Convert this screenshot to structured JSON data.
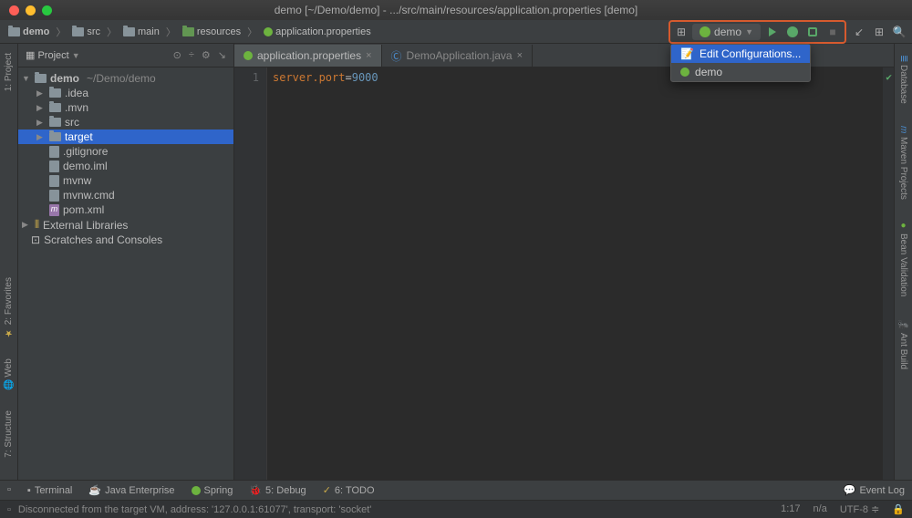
{
  "title": "demo [~/Demo/demo] - .../src/main/resources/application.properties [demo]",
  "breadcrumb": [
    "demo",
    "src",
    "main",
    "resources",
    "application.properties"
  ],
  "run_config": {
    "selected": "demo",
    "dropdown": [
      "Edit Configurations...",
      "demo"
    ]
  },
  "sidebar": {
    "header": "Project",
    "root": {
      "name": "demo",
      "path": "~/Demo/demo"
    },
    "nodes": [
      {
        "name": ".idea",
        "type": "folder",
        "depth": 1,
        "arrow": "▶"
      },
      {
        "name": ".mvn",
        "type": "folder",
        "depth": 1,
        "arrow": "▶"
      },
      {
        "name": "src",
        "type": "folder",
        "depth": 1,
        "arrow": "▶"
      },
      {
        "name": "target",
        "type": "folder-orange",
        "depth": 1,
        "arrow": "▶",
        "sel": true
      },
      {
        "name": ".gitignore",
        "type": "file",
        "depth": 1
      },
      {
        "name": "demo.iml",
        "type": "file",
        "depth": 1
      },
      {
        "name": "mvnw",
        "type": "file",
        "depth": 1
      },
      {
        "name": "mvnw.cmd",
        "type": "file",
        "depth": 1
      },
      {
        "name": "pom.xml",
        "type": "m",
        "depth": 1
      }
    ],
    "extra": [
      "External Libraries",
      "Scratches and Consoles"
    ]
  },
  "tabs": [
    {
      "label": "application.properties",
      "active": true
    },
    {
      "label": "DemoApplication.java",
      "active": false
    }
  ],
  "editor": {
    "line_no": "1",
    "key": "server.port",
    "eq": "=",
    "val": "9000"
  },
  "left_gutter": [
    "1: Project"
  ],
  "right_gutter": [
    "Database",
    "Maven Projects",
    "Bean Validation",
    "Ant Build"
  ],
  "left_gutter2": [
    "2: Favorites",
    "Web",
    "7: Structure"
  ],
  "bottom_tabs": [
    "Terminal",
    "Java Enterprise",
    "Spring",
    "5: Debug",
    "6: TODO"
  ],
  "bottom_right": "Event Log",
  "status": {
    "msg": "Disconnected from the target VM, address: '127.0.0.1:61077', transport: 'socket'",
    "pos": "1:17",
    "na": "n/a",
    "enc": "UTF-8"
  }
}
